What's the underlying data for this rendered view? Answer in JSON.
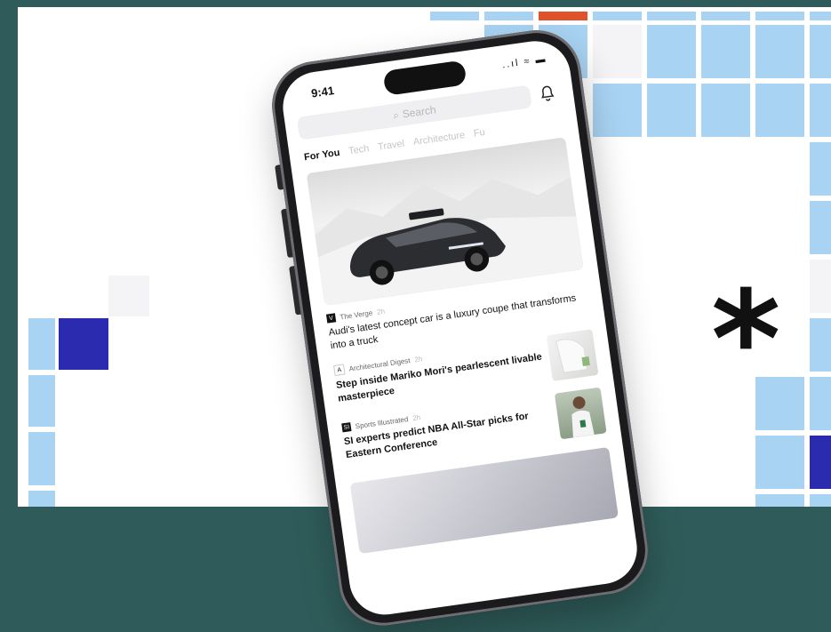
{
  "status_bar": {
    "time": "9:41",
    "icons": "..ıl ≈ ▬"
  },
  "search": {
    "placeholder": "Search"
  },
  "tabs": [
    {
      "label": "For You",
      "active": true
    },
    {
      "label": "Tech"
    },
    {
      "label": "Travel"
    },
    {
      "label": "Architecture"
    },
    {
      "label": "Fu"
    }
  ],
  "stories": [
    {
      "source": "The Verge",
      "source_time": "2h",
      "headline": "Audi's latest concept car is a luxury coupe that transforms into a truck"
    },
    {
      "source": "Architectural Digest",
      "source_time": "2h",
      "headline": "Step inside Mariko Mori's pearlescent livable masterpiece"
    },
    {
      "source": "Sports Illustrated",
      "source_time": "2h",
      "headline": "SI experts predict NBA All-Star picks for Eastern Conference"
    }
  ],
  "decoration": {
    "asterisk": "*"
  },
  "colors": {
    "tile_light": "#a9d3f3",
    "tile_dark": "#2b2bb0",
    "tile_accent": "#e0522c",
    "frame": "#2f5c5a"
  }
}
